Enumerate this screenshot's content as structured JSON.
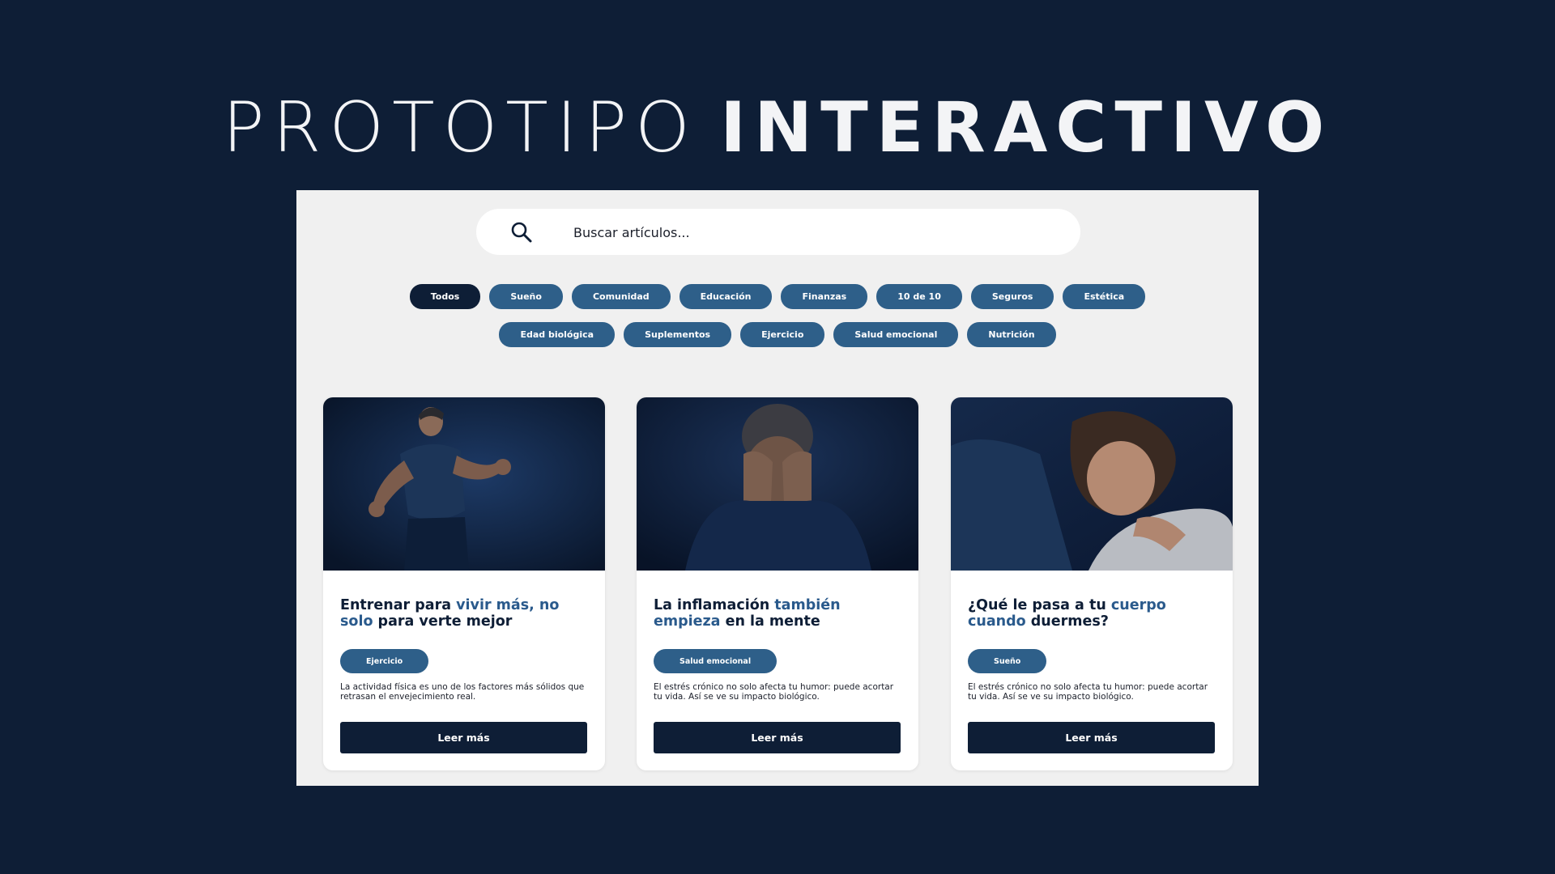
{
  "hero": {
    "title_light": "PROTOTIPO",
    "title_bold": "INTERACTIVO"
  },
  "search": {
    "icon": "search-icon",
    "placeholder": "Buscar artículos..."
  },
  "filters": {
    "row1": [
      "Todos",
      "Sueño",
      "Comunidad",
      "Educación",
      "Finanzas",
      "10 de 10",
      "Seguros",
      "Estética"
    ],
    "row2": [
      "Edad biológica",
      "Suplementos",
      "Ejercicio",
      "Salud emocional",
      "Nutrición"
    ],
    "active": "Todos"
  },
  "articles": [
    {
      "title_dark_1": "Entrenar para ",
      "title_accent_1": "vivir más, no solo",
      "title_dark_2": " para verte mejor",
      "tag": "Ejercicio",
      "excerpt": "La actividad física es uno de los factores más sólidos que retrasan el envejecimiento real.",
      "button": "Leer más",
      "image": "man-running-photo"
    },
    {
      "title_dark_1": "La inflamación ",
      "title_accent_1": "también empieza",
      "title_dark_2": " en la mente",
      "tag": "Salud emocional",
      "excerpt": "El estrés crónico no solo afecta tu humor: puede acortar tu vida. Así se ve su impacto biológico.",
      "button": "Leer más",
      "image": "stressed-man-photo"
    },
    {
      "title_dark_1": "¿Qué le pasa a tu ",
      "title_accent_1": "cuerpo cuando",
      "title_dark_2": " duermes?",
      "tag": "Sueño",
      "excerpt": "El estrés crónico no solo afecta tu humor: puede acortar tu vida. Así se ve su impacto biológico.",
      "button": "Leer más",
      "image": "woman-sleeping-photo"
    }
  ],
  "colors": {
    "background": "#0e1e36",
    "panel": "#f0f0f0",
    "chip": "#2e5f89",
    "chip_active": "#0e1e36",
    "accent_text": "#2a5a8c",
    "button": "#0e1e36"
  }
}
